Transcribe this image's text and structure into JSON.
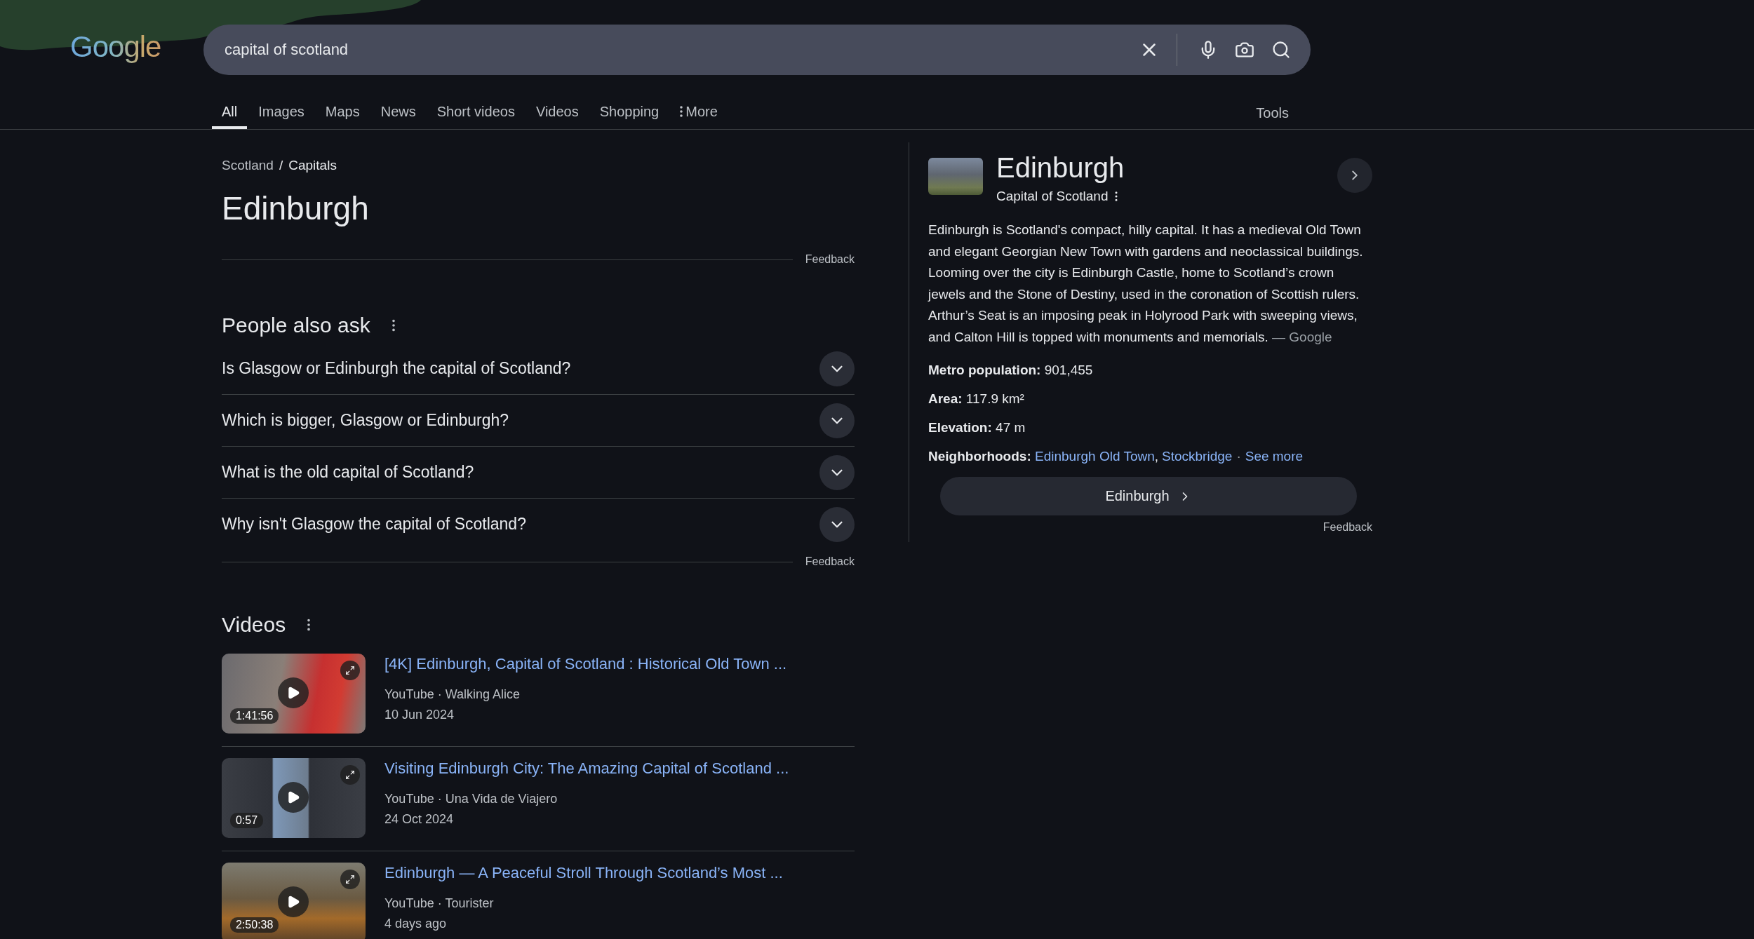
{
  "header": {
    "logo": "Google",
    "query": "capital of scotland"
  },
  "tabs": [
    {
      "label": "All",
      "selected": true,
      "kind": "tab"
    },
    {
      "label": "Images",
      "selected": false,
      "kind": "tab"
    },
    {
      "label": "Maps",
      "selected": false,
      "kind": "tab"
    },
    {
      "label": "News",
      "selected": false,
      "kind": "tab"
    },
    {
      "label": "Short videos",
      "selected": false,
      "kind": "tab"
    },
    {
      "label": "Videos",
      "selected": false,
      "kind": "tab"
    },
    {
      "label": "Shopping",
      "selected": false,
      "kind": "tab"
    },
    {
      "label": "More",
      "selected": false,
      "kind": "menu"
    }
  ],
  "tools": "Tools",
  "answer": {
    "breadcrumb": [
      "Scotland",
      "Capitals"
    ],
    "separator": "/",
    "title": "Edinburgh",
    "feedback": "Feedback"
  },
  "people_also_ask": {
    "heading": "People also ask",
    "questions": [
      {
        "text": "Is Glasgow or Edinburgh the capital of Scotland?",
        "expanded": false
      },
      {
        "text": "Which is bigger, Glasgow or Edinburgh?",
        "expanded": false
      },
      {
        "text": "What is the old capital of Scotland?",
        "expanded": false
      },
      {
        "text": "Why isn't Glasgow the capital of Scotland?",
        "expanded": false
      }
    ],
    "feedback": "Feedback"
  },
  "videos": {
    "heading": "Videos",
    "items": [
      {
        "title": "[4K] Edinburgh, Capital of Scotland : Historical Old Town ...",
        "source": "YouTube · Walking Alice",
        "date": "10 Jun 2024",
        "duration": "1:41:56"
      },
      {
        "title": "Visiting Edinburgh City: The Amazing Capital of Scotland ...",
        "source": "YouTube · Una Vida de Viajero",
        "date": "24 Oct 2024",
        "duration": "0:57"
      },
      {
        "title": "Edinburgh — A Peaceful Stroll Through Scotland’s Most ...",
        "source": "YouTube · Tourister",
        "date": "4 days ago",
        "duration": "2:50:38"
      }
    ]
  },
  "knowledge_panel": {
    "title": "Edinburgh",
    "subtitle": "Capital of Scotland",
    "description": "Edinburgh is Scotland's compact, hilly capital. It has a medieval Old Town and elegant Georgian New Town with gardens and neoclassical buildings. Looming over the city is Edinburgh Castle, home to Scotland’s crown jewels and the Stone of Destiny, used in the coronation of Scottish rulers. Arthur’s Seat is an imposing peak in Holyrood Park with sweeping views, and Calton Hill is topped with monuments and memorials.",
    "attribution": "— Google",
    "facts": [
      {
        "label": "Metro population:",
        "value": "901,455"
      },
      {
        "label": "Area:",
        "value": "117.9 km²"
      },
      {
        "label": "Elevation:",
        "value": "47 m"
      }
    ],
    "neighborhoods": {
      "label": "Neighborhoods:",
      "parts": [
        {
          "text": "Edinburgh Old Town",
          "kind": "link"
        },
        {
          "text": ",",
          "kind": "comma"
        },
        {
          "text": "Stockbridge",
          "kind": "link"
        },
        {
          "text": "·",
          "kind": "dot"
        },
        {
          "text": "See more",
          "kind": "link"
        }
      ]
    },
    "button": "Edinburgh",
    "feedback": "Feedback"
  }
}
